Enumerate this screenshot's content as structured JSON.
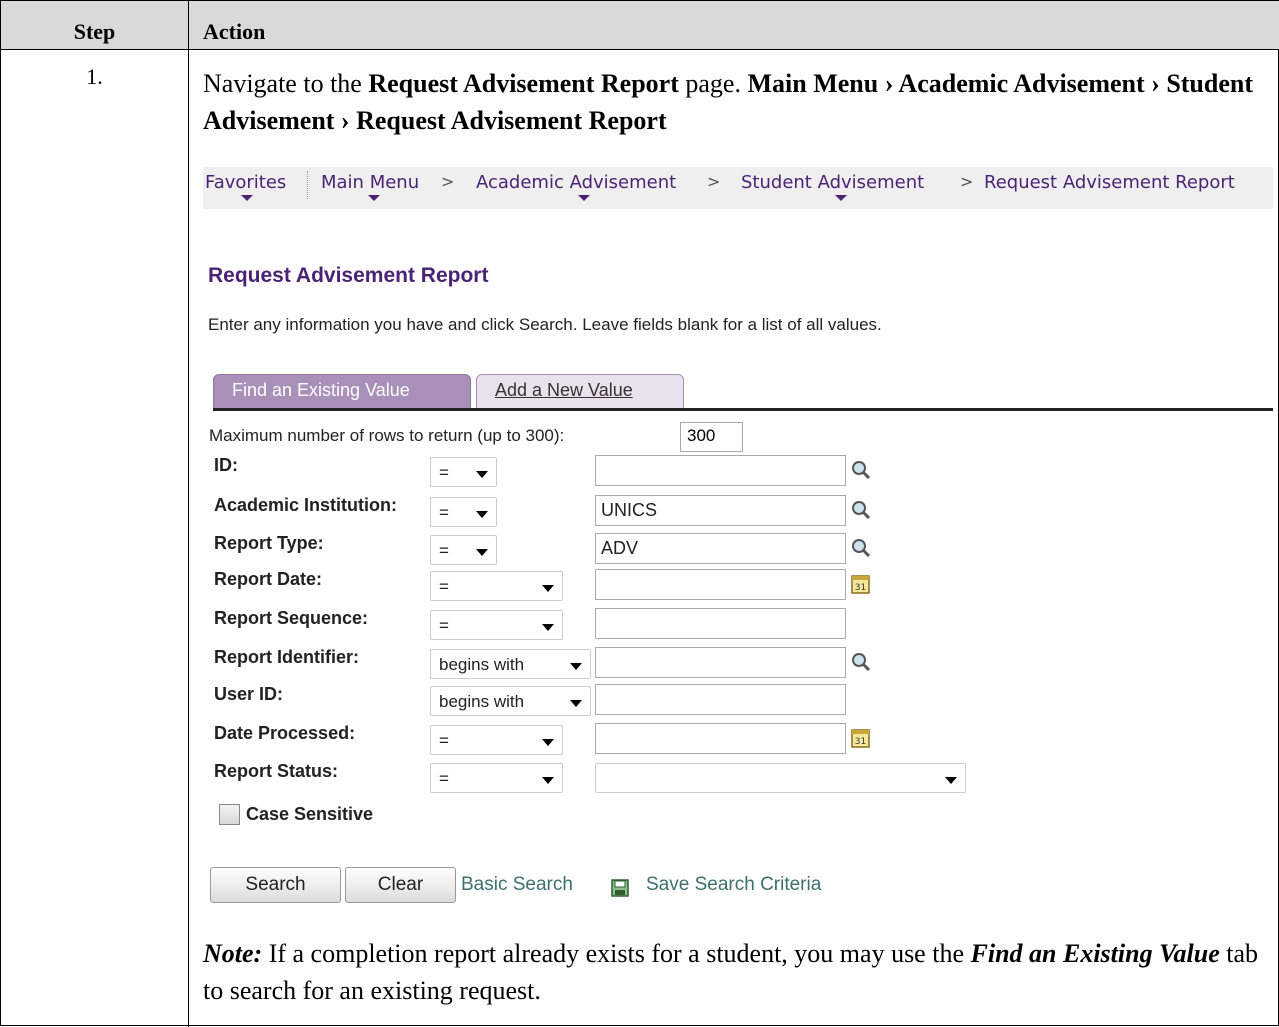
{
  "header": {
    "step": "Step",
    "action": "Action"
  },
  "step": {
    "number": "1."
  },
  "instruction": {
    "text1": "Navigate to the ",
    "page_name": "Request Advisement Report",
    "text2": " page.  ",
    "path": "Main Menu › Academic Advisement › Student Advisement › Request Advisement Report"
  },
  "breadcrumbs": {
    "favorites": "Favorites",
    "main_menu": "Main Menu",
    "academic_advisement": "Academic Advisement",
    "student_advisement": "Student Advisement",
    "current": "Request Advisement Report",
    "separator": ">"
  },
  "page": {
    "title": "Request Advisement Report",
    "description": "Enter any information you have and click Search. Leave fields blank for a list of all values.",
    "tabs": {
      "find": "Find an Existing Value",
      "add": "Add a New Value"
    },
    "max_rows_label": "Maximum number of rows to return (up to 300):",
    "max_rows_value": "300",
    "fields": [
      {
        "label": "ID:",
        "operator": "=",
        "value": ""
      },
      {
        "label": "Academic Institution:",
        "operator": "=",
        "value": "UNICS"
      },
      {
        "label": "Report Type:",
        "operator": "=",
        "value": "ADV"
      },
      {
        "label": "Report Date:",
        "operator": "=",
        "value": ""
      },
      {
        "label": "Report Sequence:",
        "operator": "=",
        "value": ""
      },
      {
        "label": "Report Identifier:",
        "operator": "begins with",
        "value": ""
      },
      {
        "label": "User ID:",
        "operator": "begins with",
        "value": ""
      },
      {
        "label": "Date Processed:",
        "operator": "=",
        "value": ""
      },
      {
        "label": "Report Status:",
        "operator": "=",
        "value": ""
      }
    ],
    "case_sensitive_label": "Case Sensitive",
    "buttons": {
      "search": "Search",
      "clear": "Clear"
    },
    "links": {
      "basic_search": "Basic Search",
      "save_criteria": "Save Search Criteria"
    },
    "icons": {
      "lookup": "magnifier-icon",
      "calendar": "calendar-icon",
      "save": "save-icon"
    }
  },
  "note": {
    "label": "Note:",
    "text1": "  If a completion report already exists for a student, you may use the ",
    "tab_ref": "Find an Existing Value",
    "text2": " tab to search for an existing request."
  },
  "colors": {
    "accent": "#4b2375",
    "tab_active": "#a890b8",
    "header_bg": "#d9d9d9",
    "link": "#3d6f6f"
  }
}
